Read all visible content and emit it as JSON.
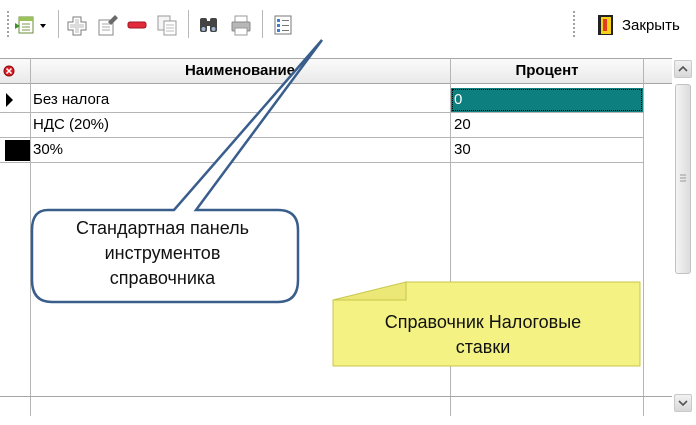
{
  "toolbar": {
    "icons": [
      "export-dropdown-icon",
      "add-icon",
      "edit-icon",
      "delete-icon",
      "copy-icon",
      "find-icon",
      "print-icon",
      "checklist-icon",
      "close-door-icon"
    ],
    "close_label": "Закрыть"
  },
  "grid": {
    "columns": [
      "Наименование",
      "Процент"
    ],
    "rows": [
      {
        "name": "Без налога",
        "percent": "0",
        "selected": true,
        "indicator": "current-row-arrow"
      },
      {
        "name": "НДС (20%)",
        "percent": "20",
        "selected": false,
        "indicator": "none"
      },
      {
        "name": "30%",
        "percent": "30",
        "selected": false,
        "indicator": "black-marker"
      }
    ]
  },
  "callouts": {
    "toolbar_note": [
      "Стандартная панель",
      "инструментов",
      "справочника"
    ],
    "reference_note": [
      "Справочник Налоговые",
      "ставки"
    ]
  },
  "colors": {
    "selection": "#0e7f7f",
    "callout_border": "#3a5e8c",
    "note_fill": "#f3f283"
  }
}
